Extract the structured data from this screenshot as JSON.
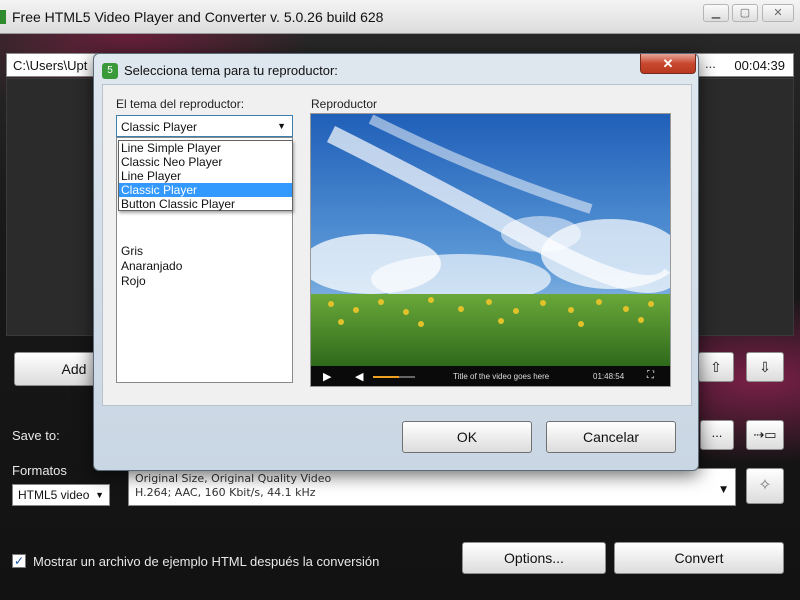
{
  "window": {
    "title": "Free HTML5 Video Player and Converter  v. 5.0.26 build 628",
    "minimize_icon": "minimize-icon",
    "maximize_icon": "maximize-icon",
    "close_icon": "close-icon"
  },
  "file_row": {
    "path": "C:\\Users\\Upt",
    "more_label": "...",
    "duration": "00:04:39"
  },
  "toolbar": {
    "add_label": "Add",
    "move_up_icon": "arrow-up-icon",
    "move_down_icon": "arrow-down-icon",
    "up_glyph": "⇧",
    "down_glyph": "⇩"
  },
  "save": {
    "label": "Save to:",
    "browse_label": "...",
    "open_folder_glyph": "⇢▭"
  },
  "formats": {
    "label": "Formatos",
    "selected": "HTML5 video",
    "preset_line1": "Original Size, Original Quality Video",
    "preset_line2": "H.264; AAC, 160 Kbit/s, 44.1 kHz",
    "wand_glyph": "✧"
  },
  "bottom": {
    "checkbox_checked": true,
    "checkbox_mark": "✓",
    "checkbox_label": "Mostrar un archivo de ejemplo HTML después la conversión",
    "options_label": "Options...",
    "convert_label": "Convert"
  },
  "dialog": {
    "title": "Selecciona tema para tu reproductor:",
    "icon_glyph": "5",
    "close_glyph": "✕",
    "theme_label": "El tema del reproductor:",
    "theme_selected": "Classic Player",
    "dropdown_options": [
      "Line Simple Player",
      "Classic Neo Player",
      "Line Player",
      "Classic Player",
      "Button Classic Player"
    ],
    "dropdown_highlighted": "Classic Player",
    "list_visible_items": [
      "Gris",
      "Anaranjado",
      "Rojo"
    ],
    "preview_label": "Reproductor",
    "player": {
      "video_title": "Title of the video goes here",
      "time": "01:48:54",
      "play_icon": "play-icon",
      "volume_icon": "volume-icon",
      "fullscreen_icon": "fullscreen-icon"
    },
    "ok_label": "OK",
    "cancel_label": "Cancelar"
  }
}
